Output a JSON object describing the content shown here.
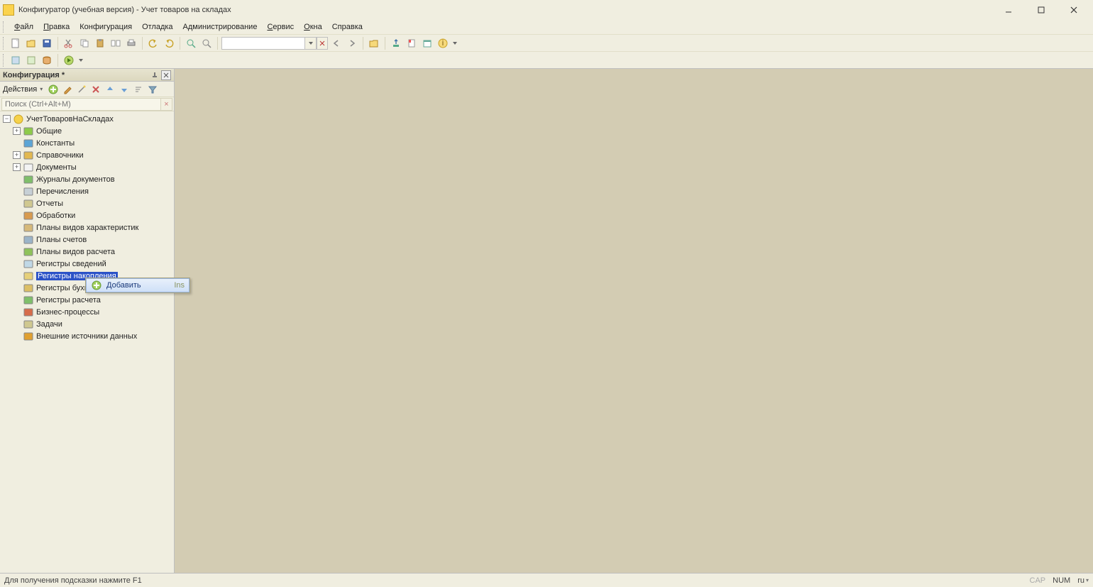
{
  "window": {
    "title": "Конфигуратор (учебная версия) - Учет товаров на складах"
  },
  "menubar": [
    {
      "label": "Файл",
      "u": 0
    },
    {
      "label": "Правка",
      "u": 0
    },
    {
      "label": "Конфигурация",
      "u": -1
    },
    {
      "label": "Отладка",
      "u": -1
    },
    {
      "label": "Администрирование",
      "u": -1
    },
    {
      "label": "Сервис",
      "u": 0
    },
    {
      "label": "Окна",
      "u": 0
    },
    {
      "label": "Справка",
      "u": -1
    }
  ],
  "side_panel": {
    "title": "Конфигурация *",
    "actions_label": "Действия",
    "search_placeholder": "Поиск (Ctrl+Alt+M)"
  },
  "tree": {
    "root": "УчетТоваровНаСкладах",
    "items": [
      {
        "label": "Общие",
        "expandable": true
      },
      {
        "label": "Константы",
        "expandable": false
      },
      {
        "label": "Справочники",
        "expandable": true
      },
      {
        "label": "Документы",
        "expandable": true
      },
      {
        "label": "Журналы документов",
        "expandable": false
      },
      {
        "label": "Перечисления",
        "expandable": false
      },
      {
        "label": "Отчеты",
        "expandable": false
      },
      {
        "label": "Обработки",
        "expandable": false
      },
      {
        "label": "Планы видов характеристик",
        "expandable": false
      },
      {
        "label": "Планы счетов",
        "expandable": false
      },
      {
        "label": "Планы видов расчета",
        "expandable": false
      },
      {
        "label": "Регистры сведений",
        "expandable": false
      },
      {
        "label": "Регистры накопления",
        "expandable": false,
        "selected": true
      },
      {
        "label": "Регистры бухгалтерии",
        "expandable": false
      },
      {
        "label": "Регистры расчета",
        "expandable": false
      },
      {
        "label": "Бизнес-процессы",
        "expandable": false
      },
      {
        "label": "Задачи",
        "expandable": false
      },
      {
        "label": "Внешние источники данных",
        "expandable": false
      }
    ]
  },
  "context_menu": {
    "items": [
      {
        "label": "Добавить",
        "shortcut": "Ins"
      }
    ]
  },
  "statusbar": {
    "hint": "Для получения подсказки нажмите F1",
    "cap": "CAP",
    "num": "NUM",
    "lang": "ru"
  },
  "icons": {
    "tree": {
      "Общие": {
        "fill": "#8ecb4a",
        "type": "dots"
      },
      "Константы": {
        "fill": "#5ca5d6",
        "type": "pi"
      },
      "Справочники": {
        "fill": "#e2b850",
        "type": "grid"
      },
      "Документы": {
        "fill": "#f3f3f3",
        "type": "doc"
      },
      "Журналы документов": {
        "fill": "#7fbf6a",
        "type": "book"
      },
      "Перечисления": {
        "fill": "#c7d0d6",
        "type": "list"
      },
      "Отчеты": {
        "fill": "#d0c890",
        "type": "sheet"
      },
      "Обработки": {
        "fill": "#d89b4f",
        "type": "gear"
      },
      "Планы видов характеристик": {
        "fill": "#d6b97a",
        "type": "brace"
      },
      "Планы счетов": {
        "fill": "#9bb4c8",
        "type": "tt"
      },
      "Планы видов расчета": {
        "fill": "#8fc25a",
        "type": "arrows"
      },
      "Регистры сведений": {
        "fill": "#c0d8e6",
        "type": "table"
      },
      "Регистры накопления": {
        "fill": "#e6d07a",
        "type": "table"
      },
      "Регистры бухгалтерии": {
        "fill": "#dcbf66",
        "type": "table"
      },
      "Регистры расчета": {
        "fill": "#7fc06a",
        "type": "table"
      },
      "Бизнес-процессы": {
        "fill": "#d66c4a",
        "type": "flow"
      },
      "Задачи": {
        "fill": "#cfc890",
        "type": "check"
      },
      "Внешние источники данных": {
        "fill": "#e0a030",
        "type": "db"
      }
    }
  }
}
